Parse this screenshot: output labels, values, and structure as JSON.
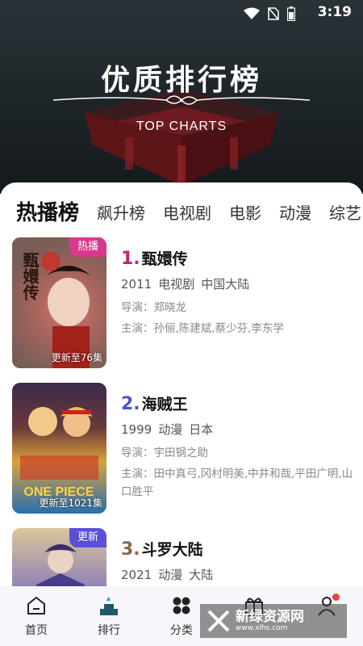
{
  "status_bar": {
    "time": "3:19"
  },
  "hero": {
    "title": "优质排行榜",
    "subtitle": "TOP CHARTS"
  },
  "tabs": [
    "热播榜",
    "飙升榜",
    "电视剧",
    "电影",
    "动漫",
    "综艺"
  ],
  "active_tab_index": 0,
  "items": [
    {
      "rank": "1.",
      "rank_color": "#c4227a",
      "title": "甄嬛传",
      "year": "2011",
      "genre": "电视剧",
      "region": "中国大陆",
      "director": "导演：郑晓龙",
      "cast": "主演：孙俪,陈建斌,蔡少芬,李东学",
      "tag": "热播",
      "tag_color": "#d63a8c",
      "update": "更新至76集",
      "poster_text": "甄嬛传"
    },
    {
      "rank": "2.",
      "rank_color": "#4a55cc",
      "title": "海贼王",
      "year": "1999",
      "genre": "动漫",
      "region": "日本",
      "director": "导演：宇田钢之助",
      "cast": "主演：田中真弓,冈村明美,中井和哉,平田广明,山口胜平",
      "tag": "",
      "tag_color": "",
      "update": "更新至1021集",
      "poster_text": ""
    },
    {
      "rank": "3.",
      "rank_color": "#8a6a48",
      "title": "斗罗大陆",
      "year": "2021",
      "genre": "动漫",
      "region": "大陆",
      "director": "",
      "cast": "",
      "tag": "更新",
      "tag_color": "#5a4fd8",
      "update": "",
      "poster_text": ""
    }
  ],
  "bottom_nav": [
    {
      "label": "首页",
      "icon": "home-icon"
    },
    {
      "label": "排行",
      "icon": "ranking-icon"
    },
    {
      "label": "分类",
      "icon": "category-icon"
    },
    {
      "label": "",
      "icon": "gift-icon"
    },
    {
      "label": "",
      "icon": "user-icon"
    }
  ],
  "watermark": {
    "text": "新绿资源网",
    "sub": "www.xlhs.com"
  }
}
